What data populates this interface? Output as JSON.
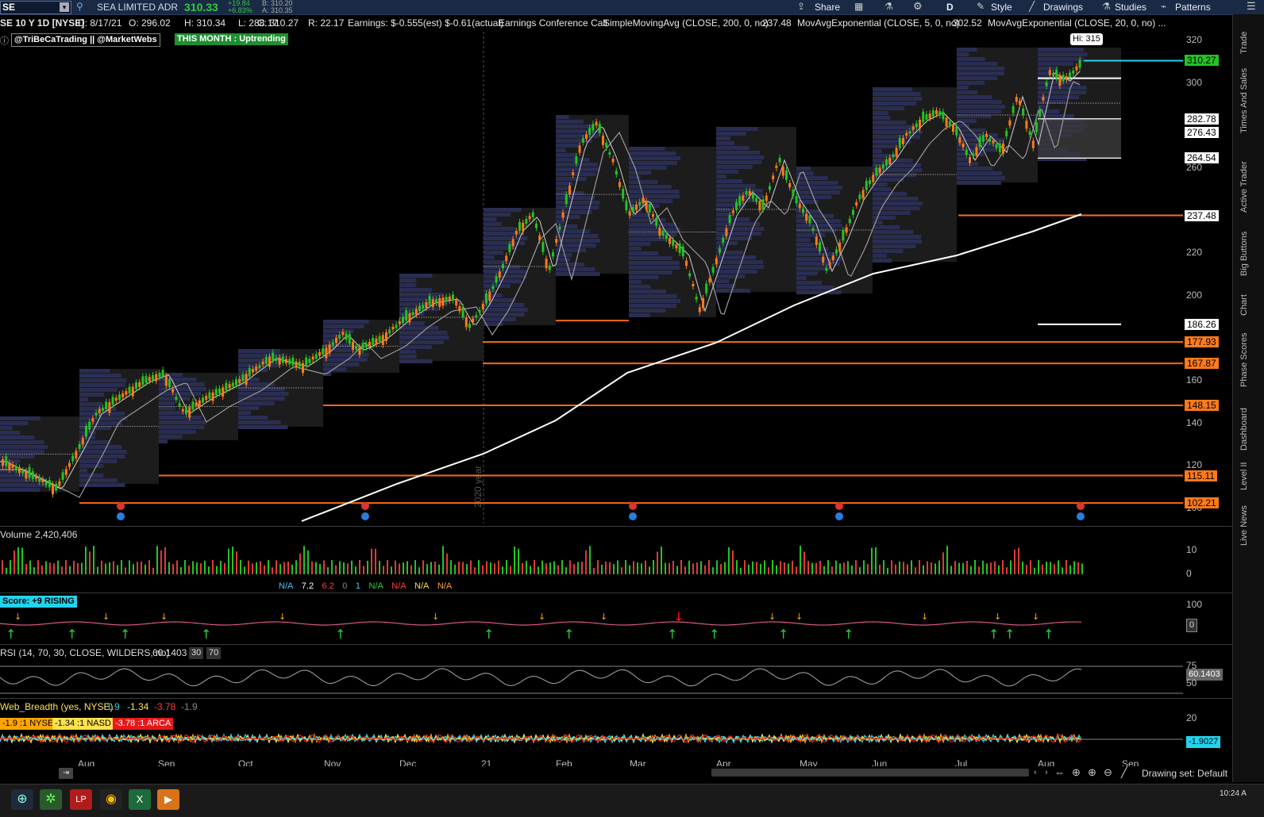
{
  "toolbar": {
    "symbol": "SE",
    "company": "SEA LIMITED ADR",
    "last": "310.33",
    "change": "+19.84",
    "change_pct": "+6.83%",
    "bid": "B: 310.20",
    "ask": "A: 310.35",
    "share": "Share",
    "aggregation": "D",
    "style": "Style",
    "drawings": "Drawings",
    "studies": "Studies",
    "patterns": "Patterns"
  },
  "info": {
    "title": "SE 10 Y 1D [NYSE]",
    "date": "D: 8/17/21",
    "open": "O: 296.02",
    "high": "H: 310.34",
    "low": "L: 288.17",
    "close": "C: 310.27",
    "range": "R: 22.17",
    "earnings": "Earnings: $-0.555(est) $-0.61(actual)",
    "earnings_call": "Earnings Conference Call",
    "sma": "SimpleMovingAvg (CLOSE, 200, 0, no)",
    "sma_val": "237.48",
    "ema5": "MovAvgExponential (CLOSE, 5, 0, no)",
    "ema5_val": "302.52",
    "ema20": "MovAvgExponential (CLOSE, 20, 0, no) ..."
  },
  "badges": {
    "credit": "@TriBeCaTrading || @MarketWebs",
    "month": "THIS MONTH : Uptrending",
    "hi": "Hi: 315"
  },
  "price_axis": {
    "ticks": [
      "320",
      "300",
      "260",
      "220",
      "200",
      "160",
      "140",
      "120",
      "100"
    ],
    "labels": [
      {
        "text": "310.27",
        "color": "#23c423"
      },
      {
        "text": "282.78",
        "color": "#ffffff"
      },
      {
        "text": "276.43",
        "color": "#ffffff"
      },
      {
        "text": "264.54",
        "color": "#ffffff"
      },
      {
        "text": "237.48",
        "color": "#ffffff"
      },
      {
        "text": "186.26",
        "color": "#ffffff"
      },
      {
        "text": "177.93",
        "color": "#ff7a1a"
      },
      {
        "text": "167.87",
        "color": "#ff7a1a"
      },
      {
        "text": "148.15",
        "color": "#ff7a1a"
      },
      {
        "text": "115.11",
        "color": "#ff7a1a"
      },
      {
        "text": "102.21",
        "color": "#ff7a1a"
      }
    ]
  },
  "watermark": "2020 year",
  "volume": {
    "label": "Volume",
    "value": "2,420,406",
    "axis_top": "10",
    "axis_bottom": "0"
  },
  "study_row": {
    "v1": "N/A",
    "v2": "7.2",
    "v3": "6.2",
    "v4": "0",
    "v5": "1",
    "v6": "N/A",
    "v7": "N/A",
    "v8": "N/A",
    "v9": "N/A"
  },
  "score": {
    "label": "Score: +9 RISING",
    "axis_top": "100",
    "axis_val": "0"
  },
  "rsi": {
    "label": "RSI (14, 70, 30, CLOSE, WILDERS, no)",
    "value": "60.1403",
    "lo": "30",
    "hi": "70",
    "axis_top": "75",
    "axis_mid": "50",
    "axis_val": "60.1403"
  },
  "breadth": {
    "label": "Web_Breadth (yes, NYSE)",
    "v1": "-1.9",
    "v2": "-1.34",
    "v3": "-3.78",
    "v4": "-1.9",
    "nyse": "-1.9 :1 NYSE",
    "nasd": "-1.34 :1 NASD",
    "arca": "-3.78 :1 ARCA",
    "axis_top": "20",
    "axis_val": "-1.9027"
  },
  "months": [
    "Aug",
    "Sep",
    "Oct",
    "Nov",
    "Dec",
    "21",
    "Feb",
    "Mar",
    "Apr",
    "May",
    "Jun",
    "Jul",
    "Aug",
    "Sep"
  ],
  "drawing_set": "Drawing set: Default",
  "right_tabs": [
    "Trade",
    "Times And Sales",
    "Active Trader",
    "Big Buttons",
    "Chart",
    "Phase Scores",
    "Dashboard",
    "Level II",
    "Live News"
  ],
  "clock": "10:24 A",
  "colors": {
    "up": "#23c423",
    "down": "#ff7a1a",
    "sma": "#ffffff",
    "level": "#ff6a10",
    "cyan": "#22d3ee"
  }
}
